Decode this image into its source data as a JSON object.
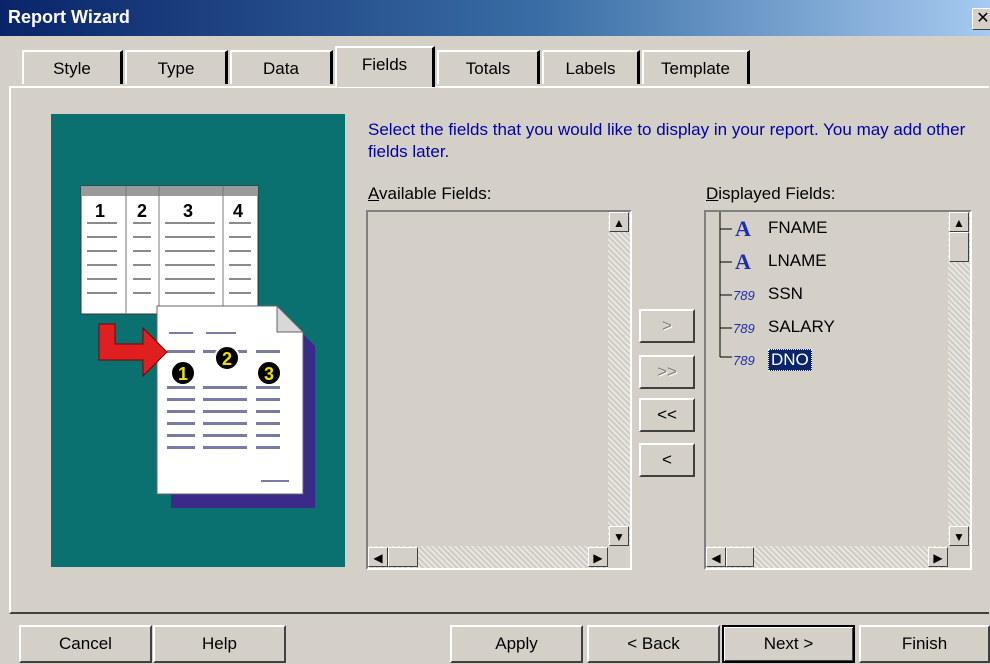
{
  "window": {
    "title": "Report Wizard",
    "close_glyph": "✕"
  },
  "tabs": [
    {
      "label": "Style"
    },
    {
      "label": "Type"
    },
    {
      "label": "Data"
    },
    {
      "label": "Fields",
      "active": true
    },
    {
      "label": "Totals"
    },
    {
      "label": "Labels"
    },
    {
      "label": "Template"
    }
  ],
  "illustration": {
    "step_numbers": [
      "1",
      "2",
      "3",
      "4"
    ],
    "badges": [
      "1",
      "2",
      "3"
    ]
  },
  "instruction": "Select the fields that you would like to display in your report. You may add other fields later.",
  "available": {
    "label_first": "A",
    "label_rest": "vailable Fields:",
    "items": []
  },
  "displayed": {
    "label_first": "D",
    "label_rest": "isplayed Fields:",
    "items": [
      {
        "name": "FNAME",
        "icon": "text-field-icon",
        "selected": false
      },
      {
        "name": "LNAME",
        "icon": "text-field-icon",
        "selected": false
      },
      {
        "name": "SSN",
        "icon": "number-field-icon",
        "selected": false
      },
      {
        "name": "SALARY",
        "icon": "number-field-icon",
        "selected": false
      },
      {
        "name": "DNO",
        "icon": "number-field-icon",
        "selected": true
      }
    ]
  },
  "move_buttons": {
    "add": ">",
    "add_all": ">>",
    "remove_all": "<<",
    "remove": "<"
  },
  "buttons": {
    "cancel": "Cancel",
    "help": "Help",
    "apply": "Apply",
    "back": "< Back",
    "next": "Next >",
    "finish": "Finish"
  },
  "colors": {
    "title_start": "#0a246a",
    "panel_teal": "#0b7070",
    "instruction_text": "#0000a8",
    "selection": "#0a246a"
  }
}
